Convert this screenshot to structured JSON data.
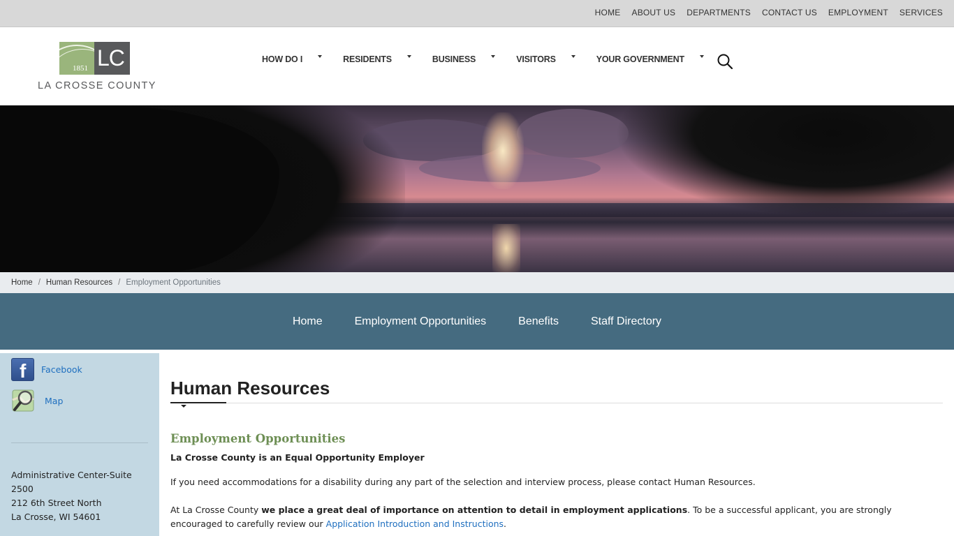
{
  "utility_nav": [
    "HOME",
    "ABOUT US",
    "DEPARTMENTS",
    "CONTACT US",
    "EMPLOYMENT",
    "SERVICES"
  ],
  "logo": {
    "year": "1851",
    "mark": "LC",
    "name": "LA CROSSE COUNTY"
  },
  "main_nav": [
    "HOW DO I",
    "RESIDENTS",
    "BUSINESS",
    "VISITORS",
    "YOUR GOVERNMENT"
  ],
  "breadcrumb": {
    "home": "Home",
    "section": "Human Resources",
    "current": "Employment Opportunities",
    "separator": "/"
  },
  "sub_nav": [
    "Home",
    "Employment Opportunities",
    "Benefits",
    "Staff Directory"
  ],
  "sidebar": {
    "facebook_label": "Facebook",
    "map_label": "Map",
    "address_lines": [
      "Administrative Center-Suite",
      "2500",
      "212 6th Street North",
      "La Crosse, WI 54601"
    ]
  },
  "content": {
    "page_title": "Human Resources",
    "section_title": "Employment Opportunities",
    "eoe": "La Crosse County is an Equal Opportunity Employer",
    "accommodations": "If you need accommodations for a disability during any part of the selection and interview process, please contact Human Resources.",
    "attention_prefix": "At La Crosse County ",
    "attention_bold": "we place a great deal of importance on attention to detail in employment applications",
    "attention_suffix": ". To be a successful applicant, you are strongly encouraged to carefully review our ",
    "attention_link": "Application Introduction and Instructions",
    "attention_end": "."
  },
  "colors": {
    "subnav_bg": "#456b80",
    "sidebar_bg": "#c3d8e3",
    "section_title": "#6e8f55",
    "link": "#1f6fbf"
  }
}
